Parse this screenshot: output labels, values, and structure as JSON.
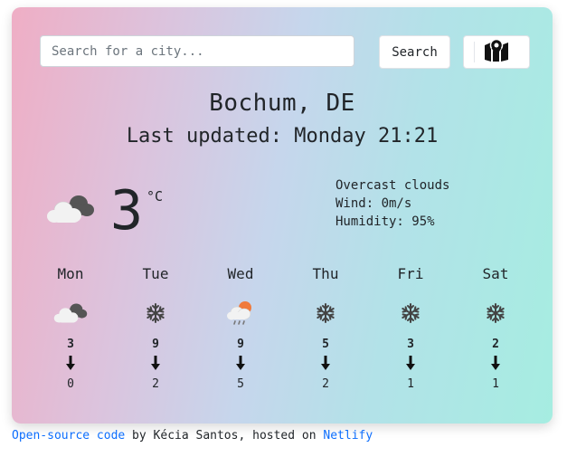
{
  "search": {
    "placeholder": "Search for a city...",
    "button_label": "Search"
  },
  "map_button": {
    "icon": "map-icon"
  },
  "location": {
    "city": "Bochum, DE",
    "last_updated": "Last updated: Monday 21:21"
  },
  "current": {
    "icon": "cloudy-icon",
    "temperature": "3",
    "unit": "°C",
    "description": "Overcast clouds",
    "wind": "Wind: 0m/s",
    "humidity": "Humidity: 95%"
  },
  "forecast": [
    {
      "day": "Mon",
      "icon": "cloudy-icon",
      "high": "3",
      "low": "0"
    },
    {
      "day": "Tue",
      "icon": "snowflake-icon",
      "high": "9",
      "low": "2"
    },
    {
      "day": "Wed",
      "icon": "rain-sun-icon",
      "high": "9",
      "low": "5"
    },
    {
      "day": "Thu",
      "icon": "snowflake-icon",
      "high": "5",
      "low": "2"
    },
    {
      "day": "Fri",
      "icon": "snowflake-icon",
      "high": "3",
      "low": "1"
    },
    {
      "day": "Sat",
      "icon": "snowflake-icon",
      "high": "2",
      "low": "1"
    }
  ],
  "footer": {
    "source_link": "Open-source code",
    "by_text": " by Kécia Santos, hosted on ",
    "host_link": "Netlify"
  },
  "colors": {
    "gradient_left": "#efaec5",
    "gradient_right": "#a6ede1",
    "link": "#0d6efd"
  }
}
